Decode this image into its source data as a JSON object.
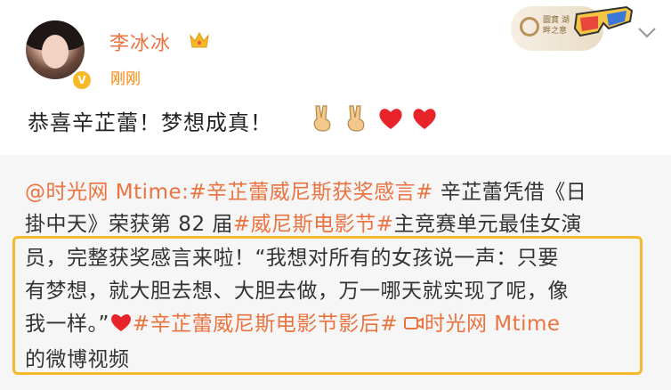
{
  "header": {
    "username": "李冰冰",
    "timestamp": "刚刚",
    "brand_badge_text": "圖寶 湖畔之意"
  },
  "post": {
    "text": "恭喜辛芷蕾！梦想成真！",
    "emojis": [
      "victory-hand",
      "victory-hand",
      "red-heart",
      "red-heart"
    ]
  },
  "repost": {
    "line1": {
      "mention": "@时光网 Mtime",
      "colon": ":",
      "hashtag": "#辛芷蕾威尼斯获奖感言#",
      "rest": " 辛芷蕾凭借《日"
    },
    "line2": {
      "pre": "掛中天》荣获第 82 届",
      "hashtag": "#威尼斯电影节#",
      "post": "主竞赛单元最佳女演"
    },
    "line3": "员，完整获奖感言来啦！“我想对所有的女孩说一声：只要",
    "line4": "有梦想，就大胆去想、大胆去做，万一哪天就实现了呢，像",
    "line5": {
      "pre": "我一样。”",
      "hashtag": "#辛芷蕾威尼斯电影节影后#",
      "video_link": "时光网 Mtime"
    },
    "line6": "的微博视频"
  },
  "colors": {
    "username": "#eb7340",
    "timestamp": "#ff8200",
    "link": "#eb7340",
    "highlight_border": "#f5b82e",
    "repost_bg": "#f6f6f6"
  }
}
